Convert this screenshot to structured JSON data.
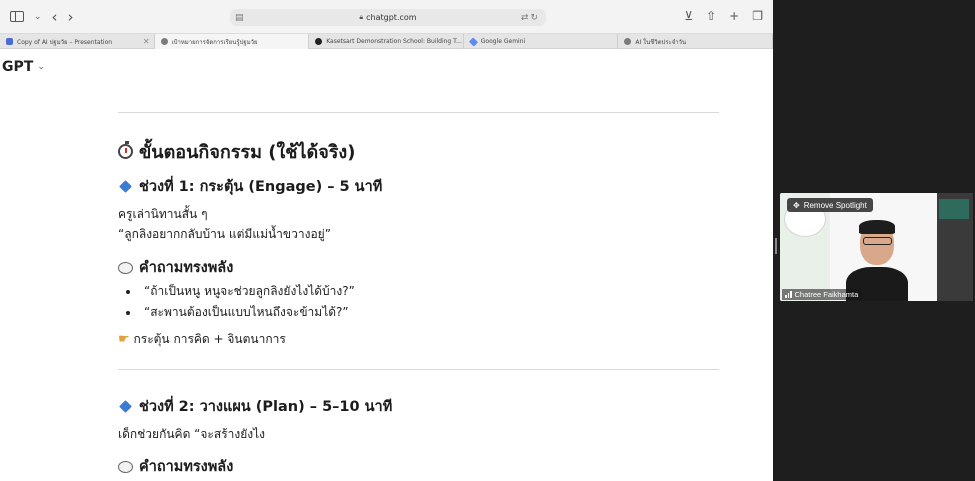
{
  "browser": {
    "address": "chatgpt.com",
    "tabs": [
      {
        "label": "Copy of AI ปฐมวัย – Presentation",
        "active": false,
        "color": "#4a6bd8"
      },
      {
        "label": "เป้าหมายการจัดการเรียนรู้ปฐมวัย",
        "active": true,
        "color": "#7b7b7b"
      },
      {
        "label": "Kasetsart Demonstration School: Building T...",
        "active": false,
        "color": "#222222"
      },
      {
        "label": "Google Gemini",
        "active": false,
        "color": "#5b8cf0"
      },
      {
        "label": "AI ในชีวิตประจำวัน",
        "active": false,
        "color": "#7b7b7b"
      }
    ]
  },
  "chat": {
    "model_label": "GPT",
    "section_title": "ขั้นตอนกิจกรรม (ใช้ได้จริง)",
    "step1": {
      "title": "ช่วงที่ 1: กระตุ้น (Engage) – 5 นาที",
      "line1": "ครูเล่านิทานสั้น ๆ",
      "line2": "“ลูกลิงอยากกลับบ้าน แต่มีแม่น้ำขวางอยู่”",
      "questions_title": "คำถามทรงพลัง",
      "questions": [
        "“ถ้าเป็นหนู หนูจะช่วยลูกลิงยังไงได้บ้าง?”",
        "“สะพานต้องเป็นแบบไหนถึงจะข้ามได้?”"
      ],
      "summary": "กระตุ้น การคิด + จินตนาการ"
    },
    "step2": {
      "title": "ช่วงที่ 2: วางแผน (Plan) – 5–10 นาที",
      "line1": "เด็กช่วยกันคิด “จะสร้างยังไง",
      "questions_title": "คำถามทรงพลัง"
    }
  },
  "video": {
    "spotlight_label": "Remove Spotlight",
    "participant_name": "Chatree Faikhamta"
  }
}
